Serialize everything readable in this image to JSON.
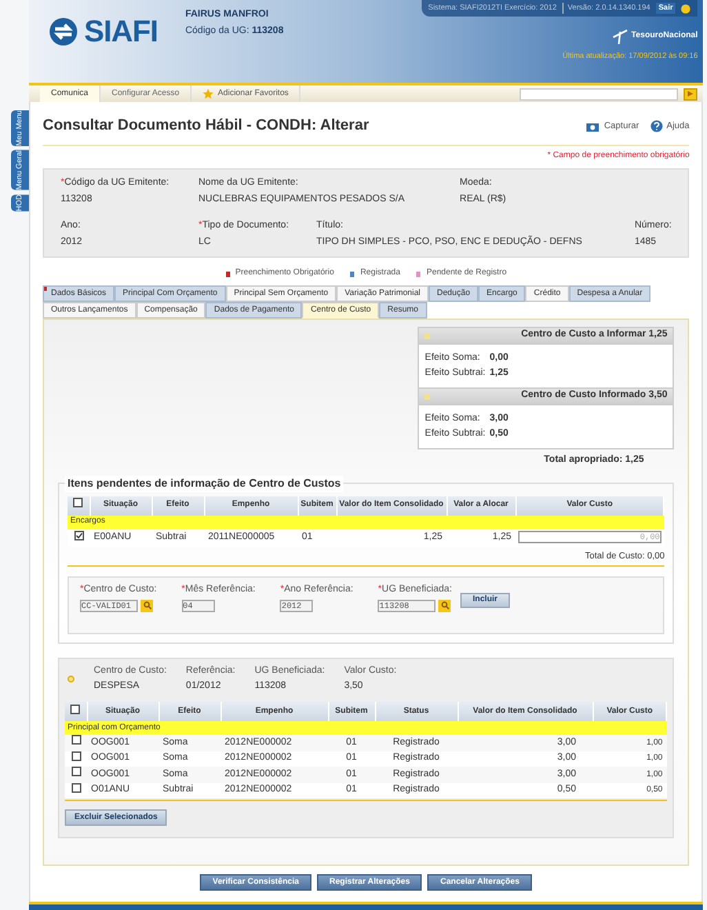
{
  "side_tabs": [
    {
      "label": "Meu Menu"
    },
    {
      "label": "Menu Geral"
    },
    {
      "label": "HOD"
    }
  ],
  "header": {
    "logo": "SIAFI",
    "user": "FAIRUS MANFROI",
    "ug_label": "Código da UG:",
    "ug": "113208",
    "system_info": "Sistema: SIAFI2012TI Exercício: 2012",
    "version": "Versão: 2.0.14.1340.194",
    "logout": "Sair",
    "brand": "TesouroNacional",
    "last_update": "Última atualização: 17/09/2012 às 09:16"
  },
  "menu": [
    {
      "label": "Comunica",
      "selected": true
    },
    {
      "label": "Configurar Acesso",
      "selected": false
    }
  ],
  "favorites": "Adicionar Favoritos",
  "title": "Consultar Documento Hábil - CONDH: Alterar",
  "actions": [
    {
      "kind": "camera",
      "label": "Capturar"
    },
    {
      "kind": "help",
      "label": "Ajuda"
    }
  ],
  "required_note": "* Campo de preenchimento obrigatório",
  "info": [
    [
      {
        "label": "Código da UG Emitente:",
        "required_mark": "*",
        "value": "113208"
      },
      {
        "label": "Nome da UG Emitente:",
        "value": "NUCLEBRAS EQUIPAMENTOS PESADOS S/A"
      },
      {
        "label": "Moeda:",
        "value": "REAL (R$)"
      }
    ],
    [
      {
        "label": "Ano:",
        "value": "2012"
      },
      {
        "label": "Tipo de Documento:",
        "required_mark": "*",
        "value": "LC"
      },
      {
        "label": "Título:",
        "value": "TIPO DH SIMPLES - PCO, PSO, ENC E DEDUÇÃO - DEFNS"
      },
      {
        "label": "Número:",
        "value": "1485"
      }
    ]
  ],
  "legend": [
    {
      "label": "Preenchimento Obrigatório",
      "color": "#c62828"
    },
    {
      "label": "Registrada",
      "color": "#4a86c5"
    },
    {
      "label": "Pendente de Registro",
      "color": "#e58fc4"
    }
  ],
  "tabs": [
    [
      {
        "label": "Dados Básicos",
        "registered": true,
        "required": true,
        "selected": false
      },
      {
        "label": "Principal Com Orçamento",
        "registered": true,
        "required": false,
        "selected": false
      },
      {
        "label": "Principal Sem Orçamento",
        "registered": false,
        "required": false,
        "selected": false
      },
      {
        "label": "Variação Patrimonial",
        "registered": false,
        "required": false,
        "selected": false
      },
      {
        "label": "Dedução",
        "registered": true,
        "required": false,
        "selected": false
      },
      {
        "label": "Encargo",
        "registered": true,
        "required": false,
        "selected": false
      },
      {
        "label": "Crédito",
        "registered": false,
        "required": false,
        "selected": false
      },
      {
        "label": "Despesa a Anular",
        "registered": true,
        "required": false,
        "selected": false
      }
    ],
    [
      {
        "label": "Outros Lançamentos",
        "registered": false,
        "required": false,
        "selected": false
      },
      {
        "label": "Compensação",
        "registered": false,
        "required": false,
        "selected": false
      },
      {
        "label": "Dados de Pagamento",
        "registered": true,
        "required": false,
        "selected": false
      },
      {
        "label": "Centro de Custo",
        "registered": false,
        "required": false,
        "selected": true
      },
      {
        "label": "Resumo",
        "registered": true,
        "required": false,
        "selected": false
      }
    ]
  ],
  "summary": [
    {
      "title": "Centro de Custo a Informar",
      "total": "1,25",
      "lines": [
        {
          "label": "Efeito Soma:",
          "value": "0,00"
        },
        {
          "label": "Efeito Subtrai:",
          "value": "1,25"
        }
      ]
    },
    {
      "title": "Centro de Custo Informado",
      "total": "3,50",
      "lines": [
        {
          "label": "Efeito Soma:",
          "value": "3,00"
        },
        {
          "label": "Efeito Subtrai:",
          "value": "0,50"
        }
      ]
    }
  ],
  "total_label": "Total apropriado:",
  "total": "1,25",
  "pending": {
    "legend": "Itens pendentes de informação de Centro de Custos",
    "all_checked": false,
    "columns": [
      "Situação",
      "Efeito",
      "Empenho",
      "Subitem",
      "Valor do Item Consolidado",
      "Valor a Alocar",
      "Valor Custo"
    ],
    "group": "Encargos",
    "rows": [
      {
        "checked": true,
        "cells": [
          "E00ANU",
          "Subtrai",
          "2011NE000005",
          "01",
          "1,25",
          "1,25"
        ],
        "cost": "0,00"
      }
    ],
    "total_label": "Total de Custo:",
    "total": "0,00",
    "fields": [
      {
        "label": "Centro de Custo:",
        "required_mark": "*",
        "value": "CC-VALID01",
        "search": true
      },
      {
        "label": "Mês Referência:",
        "required_mark": "*",
        "value": "04",
        "search": false
      },
      {
        "label": "Ano Referência:",
        "required_mark": "*",
        "value": "2012",
        "search": false
      },
      {
        "label": "UG Beneficiada:",
        "required_mark": "*",
        "value": "113208",
        "search": true
      }
    ],
    "button": "Incluir"
  },
  "allocated": {
    "expanded": true,
    "fields": [
      {
        "label": "Centro de Custo:",
        "value": "DESPESA"
      },
      {
        "label": "Referência:",
        "value": "01/2012"
      },
      {
        "label": "UG Beneficiada:",
        "value": "113208"
      },
      {
        "label": "Valor Custo:",
        "value": "3,50"
      }
    ],
    "all_checked": false,
    "columns": [
      "Situação",
      "Efeito",
      "Empenho",
      "Subitem",
      "Status",
      "Valor do Item Consolidado",
      "Valor Custo"
    ],
    "group": "Principal com Orçamento",
    "rows": [
      {
        "checked": false,
        "cells": [
          "OOG001",
          "Soma",
          "2012NE000002",
          "01",
          "Registrado",
          "3,00",
          "1,00"
        ]
      },
      {
        "checked": false,
        "cells": [
          "OOG001",
          "Soma",
          "2012NE000002",
          "01",
          "Registrado",
          "3,00",
          "1,00"
        ]
      },
      {
        "checked": false,
        "cells": [
          "OOG001",
          "Soma",
          "2012NE000002",
          "01",
          "Registrado",
          "3,00",
          "1,00"
        ]
      },
      {
        "checked": false,
        "cells": [
          "O01ANU",
          "Subtrai",
          "2012NE000002",
          "01",
          "Registrado",
          "0,50",
          "0,50"
        ]
      }
    ],
    "delete_button": "Excluir Selecionados"
  },
  "buttons": [
    "Verificar Consistência",
    "Registrar Alterações",
    "Cancelar Alterações"
  ]
}
